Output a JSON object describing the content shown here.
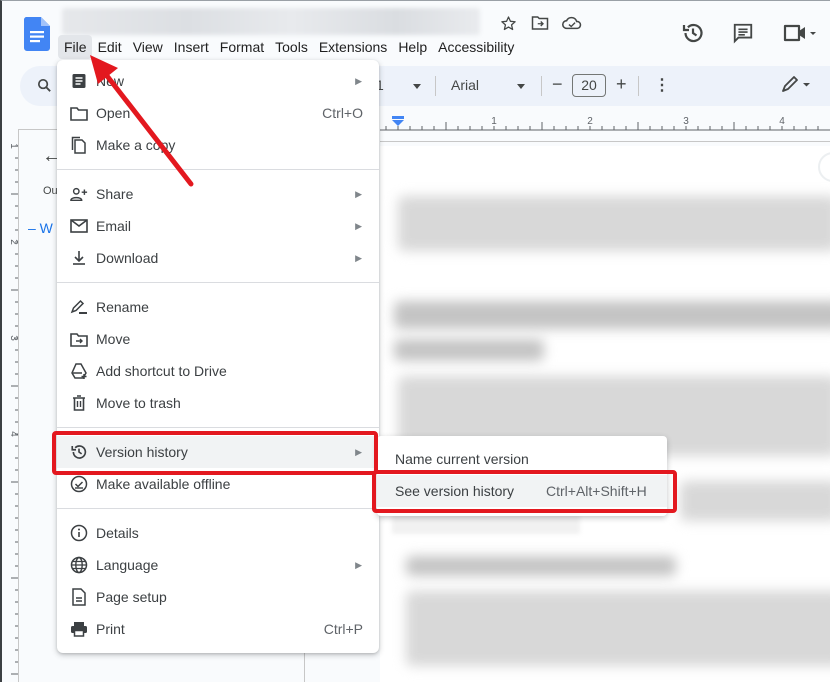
{
  "app": {
    "name": "Google Docs",
    "title_blurred": true
  },
  "title_icons": [
    "star-icon",
    "move-to-folder-icon",
    "cloud-saved-icon"
  ],
  "menubar": {
    "items": [
      "File",
      "Edit",
      "View",
      "Insert",
      "Format",
      "Tools",
      "Extensions",
      "Help",
      "Accessibility"
    ],
    "active": "File"
  },
  "header_right_icons": [
    "version-history-icon",
    "comments-icon",
    "meet-icon"
  ],
  "toolbar": {
    "zoom_partial": "1",
    "font": "Arial",
    "font_size": "20",
    "decrease": "−",
    "increase": "+",
    "more": "⋮"
  },
  "ruler": {
    "labels": [
      "1",
      "2",
      "3",
      "4"
    ],
    "vertical_labels": [
      "1",
      "2",
      "3",
      "4"
    ]
  },
  "outline": {
    "back": "←",
    "label": "Ou",
    "heading": "– W"
  },
  "file_menu": {
    "groups": [
      [
        {
          "label": "New",
          "icon": "new-doc-icon",
          "submenu": true
        },
        {
          "label": "Open",
          "icon": "folder-icon",
          "shortcut": "Ctrl+O"
        },
        {
          "label": "Make a copy",
          "icon": "copy-icon"
        }
      ],
      [
        {
          "label": "Share",
          "icon": "share-person-icon",
          "submenu": true
        },
        {
          "label": "Email",
          "icon": "email-icon",
          "submenu": true
        },
        {
          "label": "Download",
          "icon": "download-icon",
          "submenu": true
        }
      ],
      [
        {
          "label": "Rename",
          "icon": "rename-icon"
        },
        {
          "label": "Move",
          "icon": "move-folder-icon"
        },
        {
          "label": "Add shortcut to Drive",
          "icon": "drive-shortcut-icon"
        },
        {
          "label": "Move to trash",
          "icon": "trash-icon"
        }
      ],
      [
        {
          "label": "Version history",
          "icon": "history-icon",
          "submenu": true,
          "highlighted": true
        },
        {
          "label": "Make available offline",
          "icon": "offline-icon"
        }
      ],
      [
        {
          "label": "Details",
          "icon": "info-icon"
        },
        {
          "label": "Language",
          "icon": "globe-icon",
          "submenu": true
        },
        {
          "label": "Page setup",
          "icon": "page-setup-icon"
        },
        {
          "label": "Print",
          "icon": "print-icon",
          "shortcut": "Ctrl+P"
        }
      ]
    ]
  },
  "version_submenu": {
    "items": [
      {
        "label": "Name current version"
      },
      {
        "label": "See version history",
        "shortcut": "Ctrl+Alt+Shift+H",
        "highlighted": true
      }
    ]
  },
  "annotation": {
    "color": "#e3181f",
    "arrow_target": "File menu"
  },
  "colors": {
    "accent": "#1a73e8",
    "toolbar_bg": "#edf2fa",
    "menu_hover": "#f1f3f4",
    "annotation_red": "#e3181f"
  }
}
